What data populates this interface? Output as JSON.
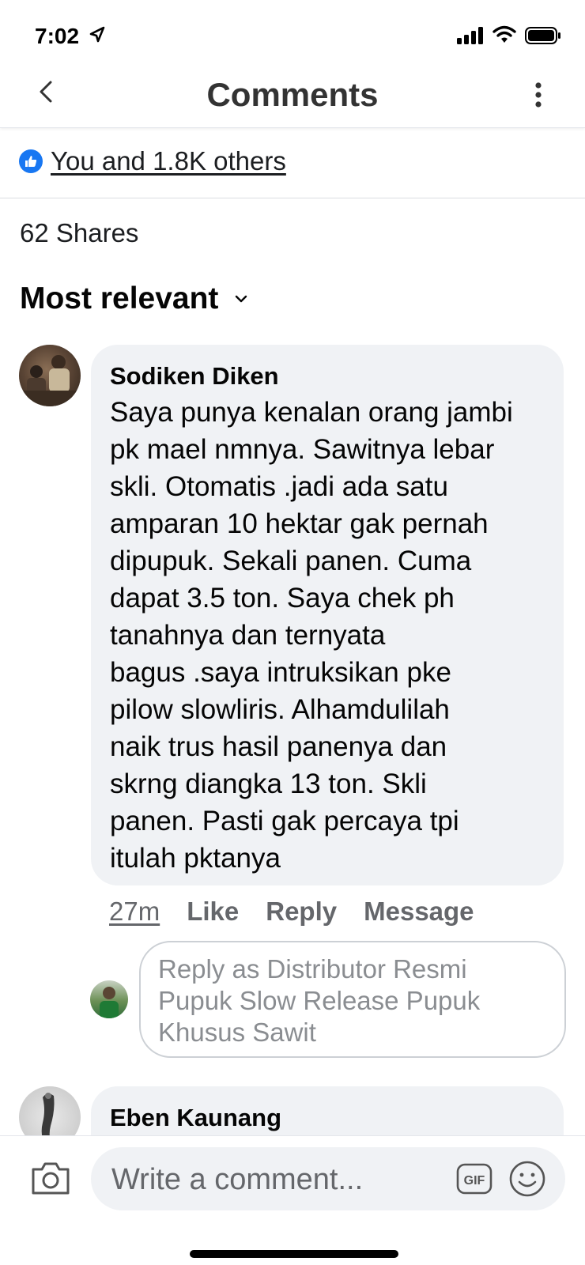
{
  "status_bar": {
    "time": "7:02"
  },
  "header": {
    "title": "Comments"
  },
  "reactions": {
    "text": "You and 1.8K others"
  },
  "shares": {
    "text": "62 Shares"
  },
  "sort": {
    "label": "Most relevant"
  },
  "comments": [
    {
      "author": "Sodiken Diken",
      "text": "Saya punya kenalan orang jambi\npk mael nmnya. Sawitnya lebar\nskli. Otomatis .jadi ada satu\namparan 10 hektar gak pernah\ndipupuk. Sekali panen. Cuma\ndapat 3.5 ton. Saya chek ph\ntanahnya dan ternyata\nbagus .saya intruksikan pke\npilow slowliris. Alhamdulilah\nnaik trus hasil panenya dan\nskrng diangka 13 ton. Skli\npanen. Pasti gak percaya tpi\nitulah pktanya",
      "time": "27m",
      "like_label": "Like",
      "reply_label": "Reply",
      "message_label": "Message"
    },
    {
      "author": "Eben Kaunang"
    }
  ],
  "reply_box": {
    "placeholder": "Reply as Distributor Resmi\nPupuk Slow Release Pupuk\nKhusus Sawit"
  },
  "composer": {
    "placeholder": "Write a comment...",
    "gif_label": "GIF"
  },
  "colors": {
    "like_blue": "#1877f2",
    "bubble_bg": "#f0f2f5",
    "secondary_text": "#65676b"
  },
  "icons": [
    "location-arrow-icon",
    "signal-icon",
    "wifi-icon",
    "battery-icon",
    "back-icon",
    "more-icon",
    "like-icon",
    "chevron-down-icon",
    "camera-icon",
    "gif-icon",
    "emoji-icon"
  ]
}
